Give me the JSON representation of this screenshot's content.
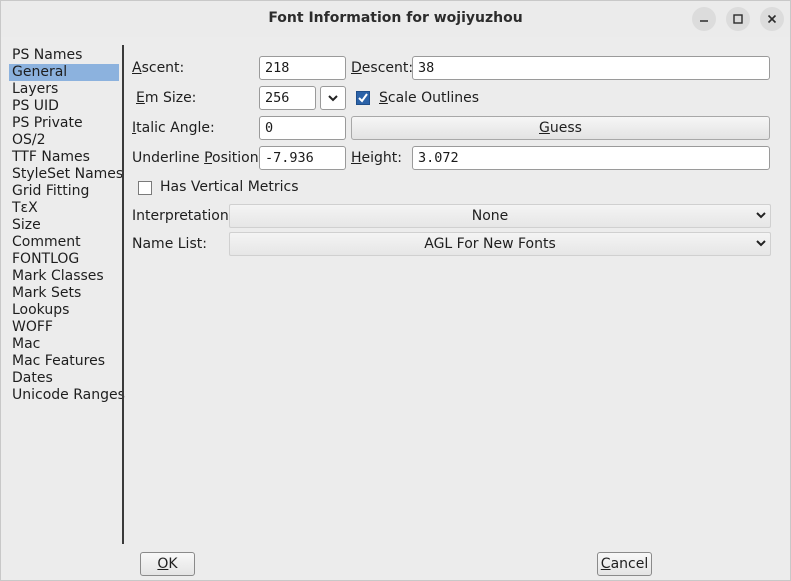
{
  "window": {
    "title": "Font Information for wojiyuzhou"
  },
  "sidebar": {
    "items": [
      {
        "label": "PS Names"
      },
      {
        "label": "General",
        "active": true
      },
      {
        "label": "Layers"
      },
      {
        "label": "PS UID"
      },
      {
        "label": "PS Private"
      },
      {
        "label": "OS/2"
      },
      {
        "label": "TTF Names"
      },
      {
        "label": "StyleSet Names"
      },
      {
        "label": "Grid Fitting"
      },
      {
        "label": "TεX"
      },
      {
        "label": "Size"
      },
      {
        "label": "Comment"
      },
      {
        "label": "FONTLOG"
      },
      {
        "label": "Mark Classes"
      },
      {
        "label": "Mark Sets"
      },
      {
        "label": "Lookups"
      },
      {
        "label": "WOFF"
      },
      {
        "label": "Mac"
      },
      {
        "label": "Mac Features"
      },
      {
        "label": "Dates"
      },
      {
        "label": "Unicode Ranges"
      }
    ]
  },
  "general": {
    "ascent_label": "Ascent:",
    "ascent_value": "218",
    "descent_label": "Descent:",
    "descent_value": "38",
    "em_size_label": "Em Size:",
    "em_size_value": "256",
    "scale_outlines_label": "Scale Outlines",
    "scale_outlines_checked": true,
    "italic_angle_label": "Italic Angle:",
    "italic_angle_value": "0",
    "guess_label": "Guess",
    "underline_position_label": "Underline Position:",
    "underline_position_value": "-7.936",
    "height_label": "Height:",
    "height_value": "3.072",
    "has_vertical_metrics_label": "Has Vertical Metrics",
    "has_vertical_metrics_checked": false,
    "interpretation_label": "Interpretation:",
    "interpretation_value": "None",
    "name_list_label": "Name List:",
    "name_list_value": "AGL For New Fonts"
  },
  "buttons": {
    "ok": "OK",
    "cancel": "Cancel"
  },
  "colors": {
    "selection": "#8cb2de",
    "checkbox_checked": "#2b62a8"
  }
}
